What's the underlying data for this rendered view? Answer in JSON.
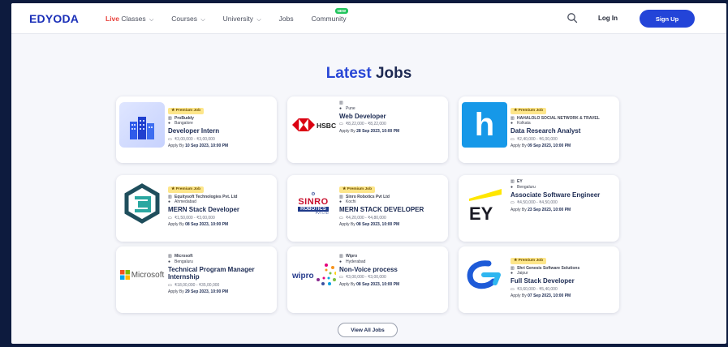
{
  "nav": {
    "logo": "EDYODA",
    "live_prefix": "Live",
    "live_suffix": " Classes",
    "courses": "Courses",
    "university": "University",
    "jobs": "Jobs",
    "community": "Community",
    "new_badge": "NEW",
    "login": "Log In",
    "signup": "Sign Up",
    "chevron": "⌵"
  },
  "section": {
    "title_accent": "Latest",
    "title_rest": " Jobs",
    "view_all": "View All Jobs"
  },
  "colors": {
    "brand": "#1a2fb8",
    "accent": "#2947d6",
    "live": "#e8413c",
    "badge": "#fde68a",
    "primary_button": "#2344d8"
  },
  "jobs": [
    {
      "premium": "Premium Job",
      "company": "ProBuddy",
      "location": "Bangalore",
      "role": "Developer Intern",
      "salary": "₹3,00,000 - ₹3,00,000",
      "apply_prefix": "Apply By ",
      "apply_date": "10 Sep 2023, 10:00 PM",
      "logo_icon": "building-icon"
    },
    {
      "premium": "",
      "company": "",
      "location": "Pune",
      "role": "Web Developer",
      "salary": "₹8,22,000 - ₹8,22,000",
      "apply_prefix": "Apply By ",
      "apply_date": "28 Sep 2023, 10:00 PM",
      "logo_icon": "hsbc-logo",
      "logo_text": "HSBC"
    },
    {
      "premium": "Premium Job",
      "company": "HAHALOLO SOCIAL NETWORK & TRAVEL",
      "location": "Kolkata",
      "role": "Data Research Analyst",
      "salary": "₹2,40,000 - ₹6,00,000",
      "apply_prefix": "Apply By ",
      "apply_date": "09 Sep 2023, 10:00 PM",
      "logo_icon": "hahalolo-logo",
      "logo_text": "h"
    },
    {
      "premium": "Premium Job",
      "company": "Equitysoft Technologies Pvt. Ltd",
      "location": "Ahmedabad",
      "role": "MERN Stack Developer",
      "salary": "₹1,50,000 - ₹3,00,000",
      "apply_prefix": "Apply By ",
      "apply_date": "08 Sep 2023, 10:00 PM",
      "logo_icon": "equitysoft-logo"
    },
    {
      "premium": "Premium Job",
      "company": "Sinro Robotics Pvt Ltd",
      "location": "Kochi",
      "role": "MERN STACK DEVELOPER",
      "salary": "₹4,20,000 - ₹4,80,000",
      "apply_prefix": "Apply By ",
      "apply_date": "08 Sep 2023, 10:00 PM",
      "logo_icon": "sinro-logo",
      "logo_text": "SINRO",
      "logo_sub": "ROBOTICS",
      "logo_sub2": "PVT LTD"
    },
    {
      "premium": "",
      "company": "EY",
      "location": "Bengaluru",
      "role": "Associate Software Engineer",
      "salary": "₹4,50,000 - ₹4,50,000",
      "apply_prefix": "Apply By ",
      "apply_date": "23 Sep 2023, 10:00 PM",
      "logo_icon": "ey-logo",
      "logo_text": "EY"
    },
    {
      "premium": "",
      "company": "Microsoft",
      "location": "Bengaluru",
      "role": "Technical Program Manager Internship",
      "salary": "₹18,00,000 - ₹35,00,000",
      "apply_prefix": "Apply By ",
      "apply_date": "29 Sep 2023, 10:00 PM",
      "logo_icon": "microsoft-logo",
      "logo_text": "Microsoft"
    },
    {
      "premium": "",
      "company": "Wipro",
      "location": "Hyderabad",
      "role": "Non-Voice process",
      "salary": "₹3,00,000 - ₹3,00,000",
      "apply_prefix": "Apply By ",
      "apply_date": "08 Sep 2023, 10:00 PM",
      "logo_icon": "wipro-logo",
      "logo_text": "wipro"
    },
    {
      "premium": "Premium Job",
      "company": "Shri Genesis Software Solutions",
      "location": "Jaipur",
      "role": "Full Stack Developer",
      "salary": "₹3,60,000 - ₹5,40,000",
      "apply_prefix": "Apply By ",
      "apply_date": "07 Sep 2023, 10:00 PM",
      "logo_icon": "shri-genesis-logo"
    }
  ]
}
